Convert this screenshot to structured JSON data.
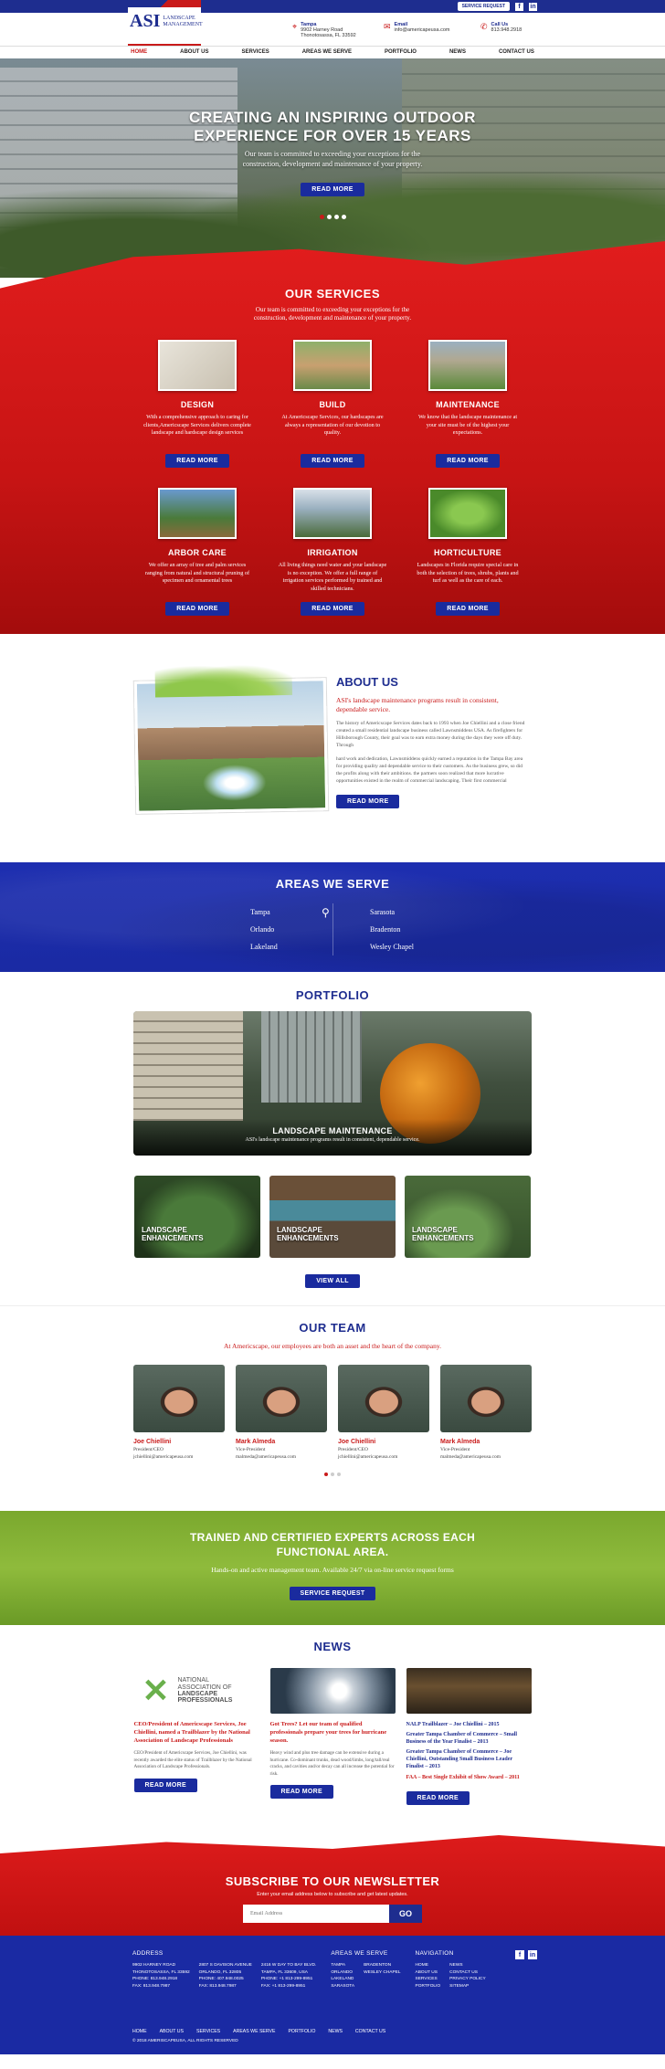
{
  "topbar": {
    "service_request": "SERVICE REQUEST",
    "social": [
      "f",
      "in"
    ]
  },
  "logo": {
    "asi": "ASI",
    "line1": "LANDSCAPE",
    "line2": "MANAGEMENT"
  },
  "contacts": [
    {
      "icon": "map-pin-icon",
      "title": "Tampa",
      "line1": "9902 Harney Road",
      "line2": "Thonotosassa, FL 33592"
    },
    {
      "icon": "mail-icon",
      "title": "Email",
      "line1": "info@americapeusa.com",
      "line2": ""
    },
    {
      "icon": "phone-icon",
      "title": "Call Us",
      "line1": "813.948.2918",
      "line2": ""
    }
  ],
  "nav": [
    "HOME",
    "ABOUT US",
    "SERVICES",
    "AREAS WE SERVE",
    "PORTFOLIO",
    "NEWS",
    "CONTACT US"
  ],
  "hero": {
    "title_l1": "CREATING AN INSPIRING OUTDOOR",
    "title_l2": "EXPERIENCE FOR OVER 15 YEARS",
    "sub_l1": "Our team is committed to exceeding your exceptions for the",
    "sub_l2": "construction, development and maintenance of your property.",
    "button": "READ MORE"
  },
  "services": {
    "title": "OUR SERVICES",
    "sub_l1": "Our team is committed to exceeding your exceptions for the",
    "sub_l2": "construction, development and maintenance of your property.",
    "items": [
      {
        "title": "DESIGN",
        "text": "With a comprehensive approach to caring for clients,Americscape Services delivers complete landscape and hardscape design services",
        "button": "READ MORE"
      },
      {
        "title": "BUILD",
        "text": "At Americscape Services, our hardscapes are always a representation of our devotion to quality.",
        "button": "READ MORE"
      },
      {
        "title": "MAINTENANCE",
        "text": "We know that the landscape maintenance at your site must be of the highest your expectations.",
        "button": "READ MORE"
      },
      {
        "title": "ARBOR CARE",
        "text": "We offer an array of tree and palm services ranging from natural and structural pruning of specimen and ornamental trees",
        "button": "READ MORE"
      },
      {
        "title": "IRRIGATION",
        "text": "All living things need water and your landscape is no exception. We offer a full range of irrigation services performed by trained and skilled technicians.",
        "button": "READ MORE"
      },
      {
        "title": "HORTICULTURE",
        "text": "Landscapes in Florida require special care in both the selection of trees, shrubs, plants and turf as well as the care of each.",
        "button": "READ MORE"
      }
    ]
  },
  "about": {
    "title": "ABOUT US",
    "lead": "ASI's landscape maintenance programs result in consistent, dependable service.",
    "p1": "The history of Americscape Services dates back to 1993 when Joe Chiellini and a close friend created a small residential landscape business called Lawnsmiddens USA. As firefighters for Hillsborough County, their goal was to earn extra money during the days they were off duty. Through",
    "p2": "hard work and dedication, Lawnsmiddens quickly earned a reputation in the Tampa Bay area for providing quality and dependable service to their customers. As the business grew, so did the profits along with their ambitions. the partners soon realized that more lucrative opportunities existed in the realm of commercial landscaping. Their first commercial",
    "button": "READ MORE"
  },
  "areas": {
    "title": "AREAS WE SERVE",
    "left": [
      "Tampa",
      "Orlando",
      "Lakeland"
    ],
    "right": [
      "Sarasota",
      "Bradenton",
      "Wesley Chapel"
    ]
  },
  "portfolio": {
    "title": "PORTFOLIO",
    "main_title": "LANDSCAPE MAINTENANCE",
    "main_sub": "ASI's landscape maintenance programs result in consistent, dependable service.",
    "tiles": [
      {
        "l1": "LANDSCAPE",
        "l2": "ENHANCEMENTS"
      },
      {
        "l1": "LANDSCAPE",
        "l2": "ENHANCEMENTS"
      },
      {
        "l1": "LANDSCAPE",
        "l2": "ENHANCEMENTS"
      }
    ],
    "button": "VIEW ALL"
  },
  "team": {
    "title": "OUR TEAM",
    "sub": "At Americscape, our employees are both an asset and the heart of the company.",
    "members": [
      {
        "name": "Joe Chiellini",
        "role": "President/CEO",
        "email": "jchiellini@americapeusa.com"
      },
      {
        "name": "Mark Almeda",
        "role": "Vice-President",
        "email": "malmeda@americapeusa.com"
      },
      {
        "name": "Joe Chiellini",
        "role": "President/CEO",
        "email": "jchiellini@americapeusa.com"
      },
      {
        "name": "Mark Almeda",
        "role": "Vice-President",
        "email": "malmeda@americapeusa.com"
      }
    ]
  },
  "cert": {
    "l1": "TRAINED AND CERTIFIED EXPERTS ACROSS EACH",
    "l2": "FUNCTIONAL AREA.",
    "sub": "Hands-on and active management team. Available 24/7 via on-line service request forms",
    "button": "SERVICE REQUEST"
  },
  "news": {
    "title": "NEWS",
    "nalp": [
      "NATIONAL",
      "ASSOCIATION OF",
      "LANDSCAPE",
      "PROFESSIONALS"
    ],
    "items": [
      {
        "headline": "CEO/President of Americscape Services, Joe Chiellini, named a Trailblazer by the National Association of Landscape Professionals",
        "body": "CEO/President of Americscape Services, Joe Chiellini, was recently awarded the elite status of Trailblazer by the National Association of Landscape Professionals.",
        "button": "READ MORE"
      },
      {
        "headline": "Got Trees? Let our team of qualified professionals prepare your trees for hurricane season.",
        "body": "Heavy wind and plus tree damage can be extensive during a hurricane. Co-dominant trunks, dead wood/limbs, long/tall/real cracks, and cavities and/or decay can all increase the potential for risk.",
        "button": "READ MORE"
      },
      {
        "headline": "",
        "body": "",
        "button": "READ MORE"
      }
    ],
    "awards": [
      {
        "a": "NALP Trailblazer – Joe Chiellini – 2015",
        "r": ""
      },
      {
        "a": "Greater Tampa Chamber of Commerce – Small Business of the Year Finalist – 2013",
        "r": ""
      },
      {
        "a": "Greater Tampa Chamber of Commerce – Joe Chiellini, Outstanding Small Business Leader Finalist – 2013",
        "r": ""
      },
      {
        "a": "",
        "r": "FAA – Best Single Exhibit of Show Award – 2011"
      }
    ]
  },
  "subscribe": {
    "title": "SUBSCRIBE TO OUR NEWSLETTER",
    "sub": "Enter your email address below to subscribe and get latest updates.",
    "placeholder": "Email Address",
    "button": "GO"
  },
  "footer": {
    "address_title": "ADDRESS",
    "addr1": [
      "9902 HARNEY ROAD",
      "THONOTOSASSA, FL 33592",
      "PHONE: 813.948.2918",
      "FAX: 813.948.7987"
    ],
    "addr2": [
      "2807 S DAVISON AVENUE",
      "ORLANDO, FL 32805",
      "PHONE: 407.948.0025",
      "FAX: 813.948.7987"
    ],
    "addr3": [
      "2416 W DAY TO BAY BLVD.",
      "TAMPA, FL 33609, USA",
      "PHONE: +1 813-299-8951",
      "FAX: +1 813-299-8951"
    ],
    "areas_title": "AREAS WE SERVE",
    "areas1": [
      "TAMPA",
      "ORLANDO",
      "LAKELAND",
      "SARASOTA"
    ],
    "areas2": [
      "BRADENTON",
      "WESLEY CHAPEL"
    ],
    "nav_title": "NAVIGATION",
    "nav1": [
      "HOME",
      "ABOUT US",
      "SERVICES",
      "PORTFOLIO"
    ],
    "nav2": [
      "NEWS",
      "CONTACT US",
      "PRIVACY POLICY",
      "SITEMAP"
    ],
    "social": [
      "f",
      "in"
    ],
    "bottom_nav": [
      "HOME",
      "ABOUT US",
      "SERVICES",
      "AREAS WE SERVE",
      "PORTFOLIO",
      "NEWS",
      "CONTACT US"
    ],
    "copyright": "© 2018 AMERISCAPEUSA, ALL RIGHTS RESERVED"
  }
}
